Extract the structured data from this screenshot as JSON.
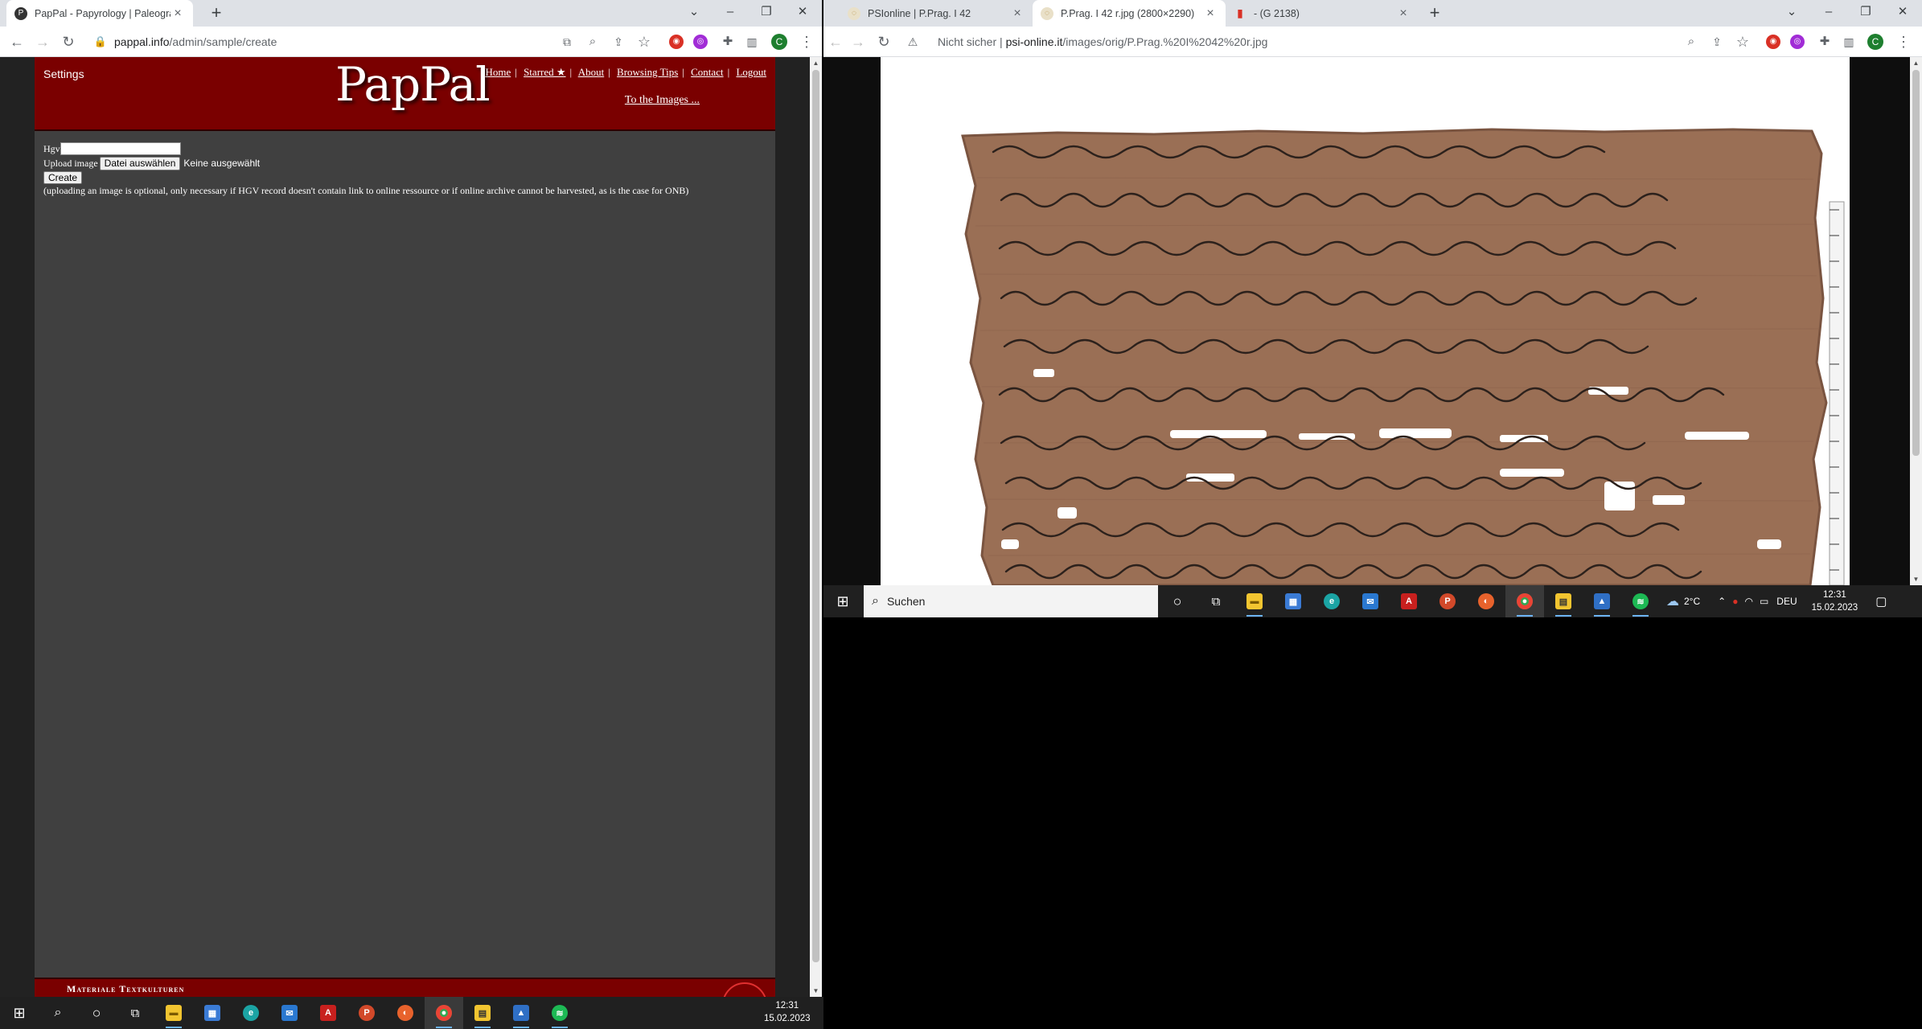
{
  "left_browser": {
    "tab": {
      "title": "PapPal - Papyrology | Paleography"
    },
    "url": {
      "host": "pappal.info",
      "path": "/admin/sample/create"
    },
    "profile_initial": "C"
  },
  "pappal": {
    "settings_label": "Settings",
    "logo": "PapPal",
    "nav": [
      "Home",
      "Starred ★",
      "About",
      "Browsing Tips",
      "Contact",
      "Logout"
    ],
    "to_images": "To the Images ...",
    "form": {
      "hgv_label": "Hgv",
      "hgv_value": "",
      "upload_label": "Upload image",
      "file_button": "Datei auswählen",
      "file_status": "Keine ausgewählt",
      "create_button": "Create",
      "note": "(uploading an image is optional, only necessary if HGV record doesn't contain link to online ressource or if online archive cannot be harvested, as is the case for ONB)"
    },
    "footer_text": "Materiale Textkulturen"
  },
  "right_browser": {
    "tabs": [
      {
        "title": "PSIonline | P.Prag. I 42"
      },
      {
        "title": "P.Prag. I 42 r.jpg (2800×2290)"
      },
      {
        "title": "- (G 2138)"
      }
    ],
    "security": "Nicht sicher",
    "url": {
      "host": "psi-online.it",
      "path": "/images/orig/P.Prag.%20I%2042%20r.jpg"
    },
    "profile_initial": "C"
  },
  "taskbar_left": {
    "time": "12:31",
    "date": "15.02.2023"
  },
  "taskbar_right": {
    "search_placeholder": "Suchen",
    "weather": "2°C",
    "lang": "DEU",
    "time": "12:31",
    "date": "15.02.2023"
  },
  "colors": {
    "pappal_red": "#7a0000",
    "pappal_grey": "#404040",
    "papyrus": "#9a6f55"
  }
}
